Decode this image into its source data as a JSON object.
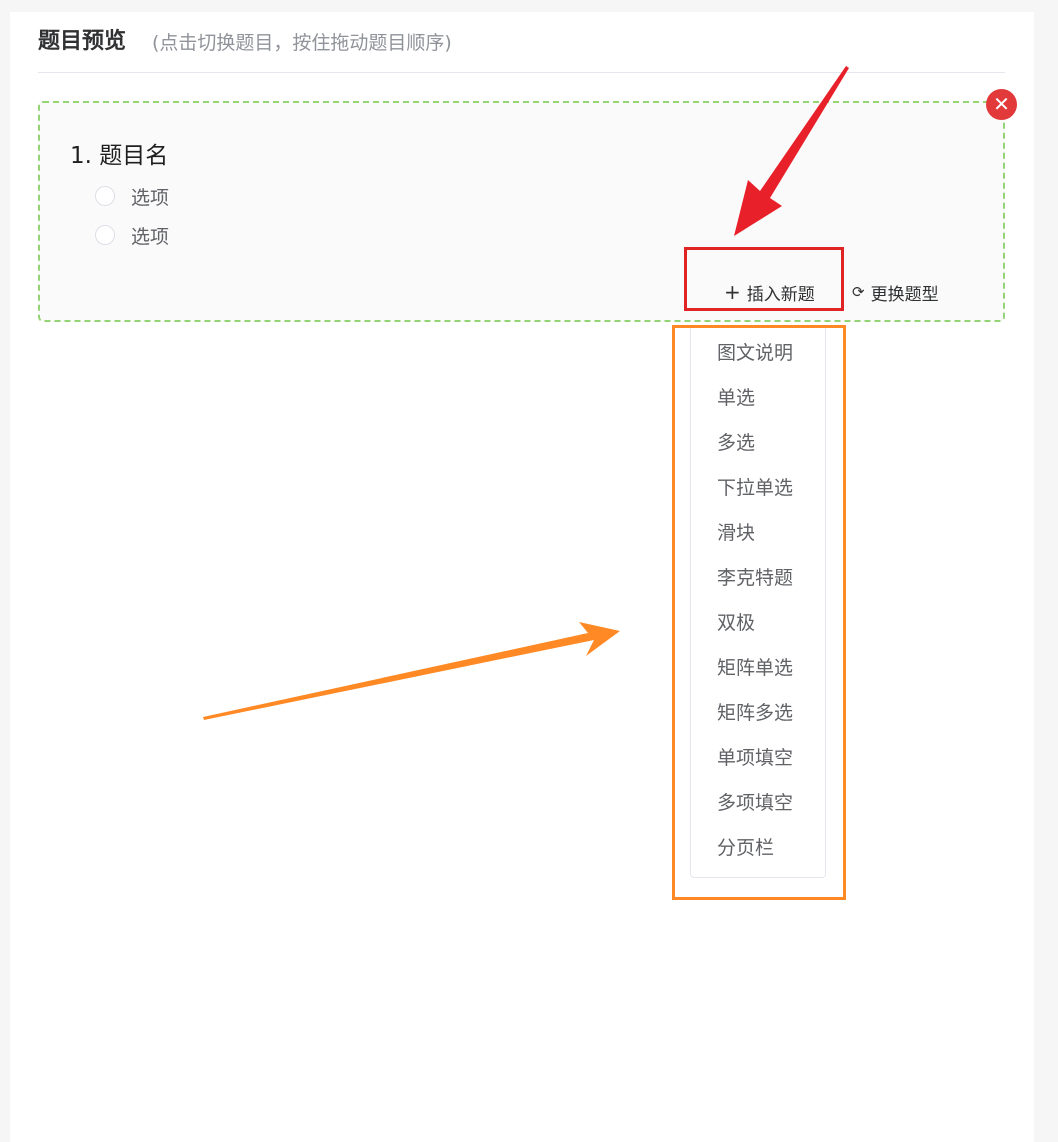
{
  "header": {
    "title": "题目预览",
    "hint": "(点击切换题目，按住拖动题目顺序)"
  },
  "question": {
    "title": "1. 题目名",
    "options": [
      "选项",
      "选项"
    ],
    "close_icon": "close-icon",
    "insert_label": "插入新题",
    "change_label": "更换题型"
  },
  "dropdown": {
    "items": [
      "图文说明",
      "单选",
      "多选",
      "下拉单选",
      "滑块",
      "李克特题",
      "双极",
      "矩阵单选",
      "矩阵多选",
      "单项填空",
      "多项填空",
      "分页栏"
    ]
  },
  "colors": {
    "dashed_border": "#95d475",
    "close_button": "#e23a3a",
    "red_annotation": "#e02424",
    "orange_annotation": "#ff8a25"
  },
  "icons": {
    "insert": "plus-icon",
    "change": "refresh-icon",
    "close": "close-icon"
  }
}
